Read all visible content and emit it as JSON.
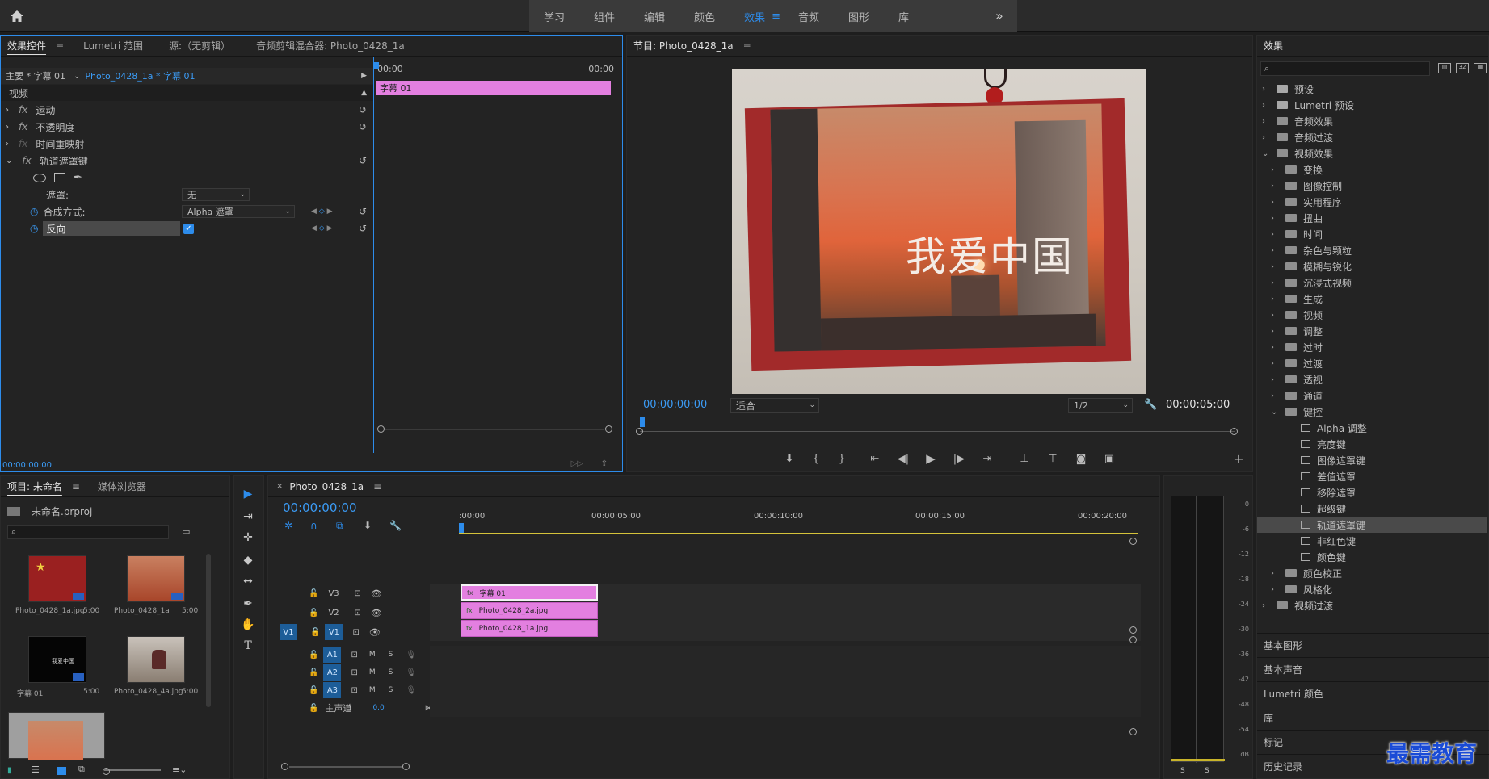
{
  "workspace": {
    "tabs": [
      "学习",
      "组件",
      "编辑",
      "颜色",
      "效果",
      "音频",
      "图形",
      "库"
    ],
    "active": "效果",
    "more": "»"
  },
  "effect_controls": {
    "tabs": [
      "效果控件",
      "Lumetri 范围",
      "源:（无剪辑）",
      "音频剪辑混合器: Photo_0428_1a"
    ],
    "master_label": "主要 * 字幕 01",
    "clip_label": "Photo_0428_1a * 字幕 01",
    "time_start": "00:00",
    "time_end": "00:00",
    "clip_bar_label": "字幕 01",
    "section_video": "视频",
    "effects": [
      "运动",
      "不透明度",
      "时间重映射",
      "轨道遮罩键"
    ],
    "mask_label": "遮罩:",
    "mask_value": "无",
    "composite_label": "合成方式:",
    "composite_value": "Alpha 遮罩",
    "reverse_label": "反向",
    "reverse_checked": true,
    "timecode": "00:00:00:00"
  },
  "program": {
    "title": "节目: Photo_0428_1a",
    "overlay_text": "我爱中国",
    "timecode_left": "00:00:00:00",
    "fit": "适合",
    "quality": "1/2",
    "timecode_right": "00:00:05:00"
  },
  "effects_panel": {
    "title": "效果",
    "tree": [
      {
        "label": "预设",
        "level": 0,
        "kind": "preset",
        "open": false
      },
      {
        "label": "Lumetri 预设",
        "level": 0,
        "kind": "preset",
        "open": false
      },
      {
        "label": "音频效果",
        "level": 0,
        "kind": "folder",
        "open": false
      },
      {
        "label": "音频过渡",
        "level": 0,
        "kind": "folder",
        "open": false
      },
      {
        "label": "视频效果",
        "level": 0,
        "kind": "folder",
        "open": true
      },
      {
        "label": "变换",
        "level": 1,
        "kind": "folder",
        "open": false
      },
      {
        "label": "图像控制",
        "level": 1,
        "kind": "folder",
        "open": false
      },
      {
        "label": "实用程序",
        "level": 1,
        "kind": "folder",
        "open": false
      },
      {
        "label": "扭曲",
        "level": 1,
        "kind": "folder",
        "open": false
      },
      {
        "label": "时间",
        "level": 1,
        "kind": "folder",
        "open": false
      },
      {
        "label": "杂色与颗粒",
        "level": 1,
        "kind": "folder",
        "open": false
      },
      {
        "label": "模糊与锐化",
        "level": 1,
        "kind": "folder",
        "open": false
      },
      {
        "label": "沉浸式视频",
        "level": 1,
        "kind": "folder",
        "open": false
      },
      {
        "label": "生成",
        "level": 1,
        "kind": "folder",
        "open": false
      },
      {
        "label": "视频",
        "level": 1,
        "kind": "folder",
        "open": false
      },
      {
        "label": "调整",
        "level": 1,
        "kind": "folder",
        "open": false
      },
      {
        "label": "过时",
        "level": 1,
        "kind": "folder",
        "open": false
      },
      {
        "label": "过渡",
        "level": 1,
        "kind": "folder",
        "open": false
      },
      {
        "label": "透视",
        "level": 1,
        "kind": "folder",
        "open": false
      },
      {
        "label": "通道",
        "level": 1,
        "kind": "folder",
        "open": false
      },
      {
        "label": "键控",
        "level": 1,
        "kind": "folder",
        "open": true
      },
      {
        "label": "Alpha 调整",
        "level": 2,
        "kind": "effect"
      },
      {
        "label": "亮度键",
        "level": 2,
        "kind": "effect"
      },
      {
        "label": "图像遮罩键",
        "level": 2,
        "kind": "effect"
      },
      {
        "label": "差值遮罩",
        "level": 2,
        "kind": "effect"
      },
      {
        "label": "移除遮罩",
        "level": 2,
        "kind": "effect"
      },
      {
        "label": "超级键",
        "level": 2,
        "kind": "effect"
      },
      {
        "label": "轨道遮罩键",
        "level": 2,
        "kind": "effect",
        "selected": true
      },
      {
        "label": "非红色键",
        "level": 2,
        "kind": "effect"
      },
      {
        "label": "颜色键",
        "level": 2,
        "kind": "effect"
      },
      {
        "label": "颜色校正",
        "level": 1,
        "kind": "folder",
        "open": false
      },
      {
        "label": "风格化",
        "level": 1,
        "kind": "folder",
        "open": false
      },
      {
        "label": "视频过渡",
        "level": 0,
        "kind": "folder",
        "open": false
      }
    ],
    "bottom": [
      "基本图形",
      "基本声音",
      "Lumetri 颜色",
      "库",
      "标记",
      "历史记录"
    ]
  },
  "project": {
    "tabs": [
      "项目: 未命名",
      "媒体浏览器"
    ],
    "file": "未命名.prproj",
    "items": [
      {
        "name": "Photo_0428_1a.jpg",
        "dur": "5:00"
      },
      {
        "name": "Photo_0428_1a",
        "dur": "5:00"
      },
      {
        "name": "字幕 01",
        "dur": "5:00"
      },
      {
        "name": "Photo_0428_4a.jpg",
        "dur": "5:00"
      }
    ],
    "thumb_text": "我爱中国"
  },
  "timeline": {
    "title": "Photo_0428_1a",
    "timecode": "00:00:00:00",
    "ruler": [
      ":00:00",
      "00:00:05:00",
      "00:00:10:00",
      "00:00:15:00",
      "00:00:20:00"
    ],
    "video_tracks": [
      "V3",
      "V2",
      "V1"
    ],
    "audio_tracks": [
      "A1",
      "A2",
      "A3"
    ],
    "source_patch": "V1",
    "mute": "M",
    "solo": "S",
    "master_label": "主声道",
    "master_value": "0.0",
    "clips": [
      {
        "name": "字幕 01",
        "track": "V3"
      },
      {
        "name": "Photo_0428_2a.jpg",
        "track": "V2"
      },
      {
        "name": "Photo_0428_1a.jpg",
        "track": "V1"
      }
    ]
  },
  "meter": {
    "scale": [
      "0",
      "-6",
      "-12",
      "-18",
      "-24",
      "-30",
      "-36",
      "-42",
      "-48",
      "-54",
      "dB"
    ],
    "solo": [
      "S",
      "S"
    ]
  },
  "watermark": "最需教育"
}
